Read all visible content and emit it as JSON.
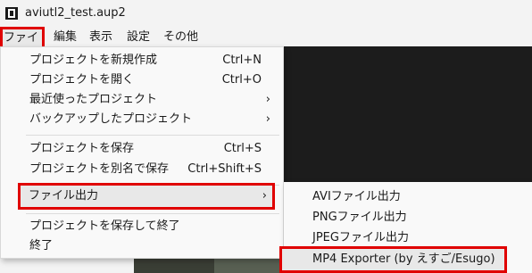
{
  "window": {
    "title": "aviutl2_test.aup2"
  },
  "menubar": {
    "items": [
      "ファイル",
      "編集",
      "表示",
      "設定",
      "その他"
    ]
  },
  "file_menu": {
    "items": [
      {
        "label": "プロジェクトを新規作成",
        "shortcut": "Ctrl+N"
      },
      {
        "label": "プロジェクトを開く",
        "shortcut": "Ctrl+O"
      },
      {
        "label": "最近使ったプロジェクト",
        "arrow": "›"
      },
      {
        "label": "バックアップしたプロジェクト",
        "arrow": "›"
      },
      {
        "label": "プロジェクトを保存",
        "shortcut": "Ctrl+S"
      },
      {
        "label": "プロジェクトを別名で保存",
        "shortcut": "Ctrl+Shift+S"
      },
      {
        "label": "ファイル出力",
        "arrow": "›",
        "highlighted": true
      },
      {
        "label": "プロジェクトを保存して終了"
      },
      {
        "label": "終了"
      }
    ]
  },
  "export_submenu": {
    "items": [
      {
        "label": "AVIファイル出力"
      },
      {
        "label": "PNGファイル出力"
      },
      {
        "label": "JPEGファイル出力"
      },
      {
        "label": "MP4 Exporter (by えすご/Esugo)",
        "highlighted": true
      }
    ]
  },
  "colors": {
    "highlight_border": "#e00000",
    "menu_bg": "#f9f9f9",
    "preview_bg": "#1c1c1c"
  }
}
